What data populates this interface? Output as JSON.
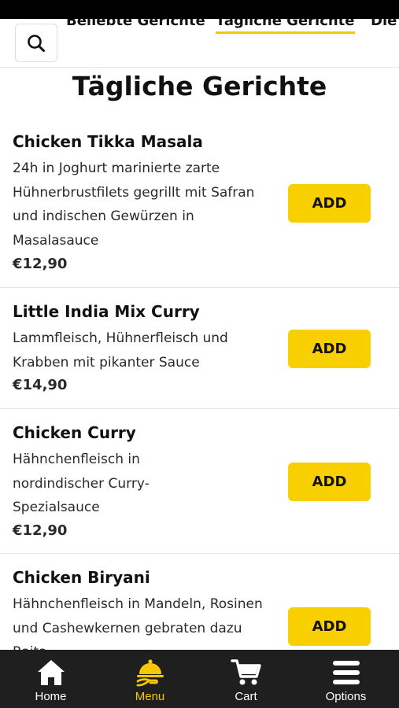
{
  "header": {
    "tabs": [
      {
        "label": "Beliebte Gerichte"
      },
      {
        "label": "Tägliche Gerichte"
      },
      {
        "label": "Die"
      }
    ]
  },
  "section": {
    "title": "Tägliche Gerichte"
  },
  "items": [
    {
      "name": "Chicken Tikka Masala",
      "desc": "24h in Joghurt marinierte zarte Hühnerbrustfilets gegrillt mit Safran und indischen Gewürzen in Masalasauce",
      "price": "€12,90",
      "button": "ADD"
    },
    {
      "name": "Little India Mix Curry",
      "desc": "Lammfleisch, Hühnerfleisch und Krabben mit pikanter Sauce",
      "price": "€14,90",
      "button": "ADD"
    },
    {
      "name": "Chicken Curry",
      "desc": "Hähnchenfleisch in nordindischer Curry-Spezialsauce",
      "price": "€12,90",
      "button": "ADD"
    },
    {
      "name": "Chicken Biryani",
      "desc": "Hähnchenfleisch in Mandeln, Rosinen und Cashewkernen gebraten dazu Raita",
      "price": "",
      "button": "ADD"
    }
  ],
  "nav": {
    "items": [
      {
        "label": "Home",
        "icon": "home-icon"
      },
      {
        "label": "Menu",
        "icon": "cloche-icon"
      },
      {
        "label": "Cart",
        "icon": "cart-icon"
      },
      {
        "label": "Options",
        "icon": "menu-icon"
      }
    ]
  },
  "colors": {
    "accent": "#f8cf00",
    "nav_background": "#1f1f1f",
    "status_bar": "#000000"
  }
}
